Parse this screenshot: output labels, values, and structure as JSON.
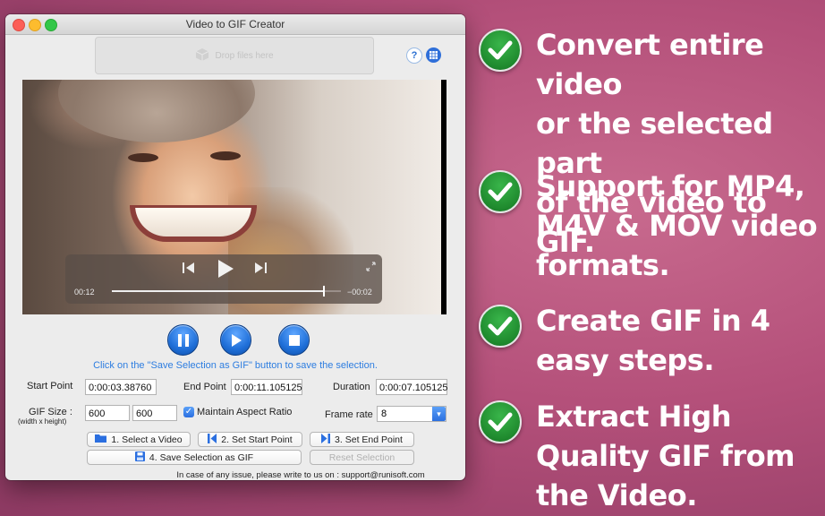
{
  "window": {
    "title": "Video to GIF Creator"
  },
  "dropzone": {
    "label": "Drop files here"
  },
  "header": {
    "help_label": "?"
  },
  "player": {
    "current_time": "00:12",
    "remaining_time": "−00:02",
    "progress": 0.92
  },
  "hint": "Click on the \"Save Selection as GIF\" button to save the selection.",
  "form": {
    "start_label": "Start Point",
    "start_value": "0:00:03.38760",
    "end_label": "End Point",
    "end_value": "0:00:11.105125",
    "duration_label": "Duration",
    "duration_value": "0:00:07.105125",
    "gif_size_label": "GIF Size :",
    "gif_size_sub": "(width x height)",
    "width_value": "600",
    "height_value": "600",
    "aspect_label": "Maintain Aspect Ratio",
    "aspect_checked": true,
    "framerate_label": "Frame rate",
    "framerate_value": "8"
  },
  "buttons": {
    "select_video": "1. Select a Video",
    "set_start": "2. Set Start Point",
    "set_end": "3. Set End Point",
    "save_selection": "4. Save Selection as GIF",
    "reset_selection": "Reset Selection"
  },
  "footer": "In case of any issue, please write to us on : support@runisoft.com",
  "features": [
    {
      "lines": [
        "Convert entire video",
        "or the selected part",
        "of the video to GIF."
      ]
    },
    {
      "lines": [
        "Support for MP4,",
        "M4V & MOV video",
        "formats."
      ]
    },
    {
      "lines": [
        "Create GIF in 4",
        "easy steps."
      ]
    },
    {
      "lines": [
        "Extract High",
        "Quality GIF from",
        "the Video."
      ]
    }
  ],
  "colors": {
    "accent": "#2d7de0",
    "badge_green": "#1f8a2e",
    "background": "#b4507a"
  }
}
